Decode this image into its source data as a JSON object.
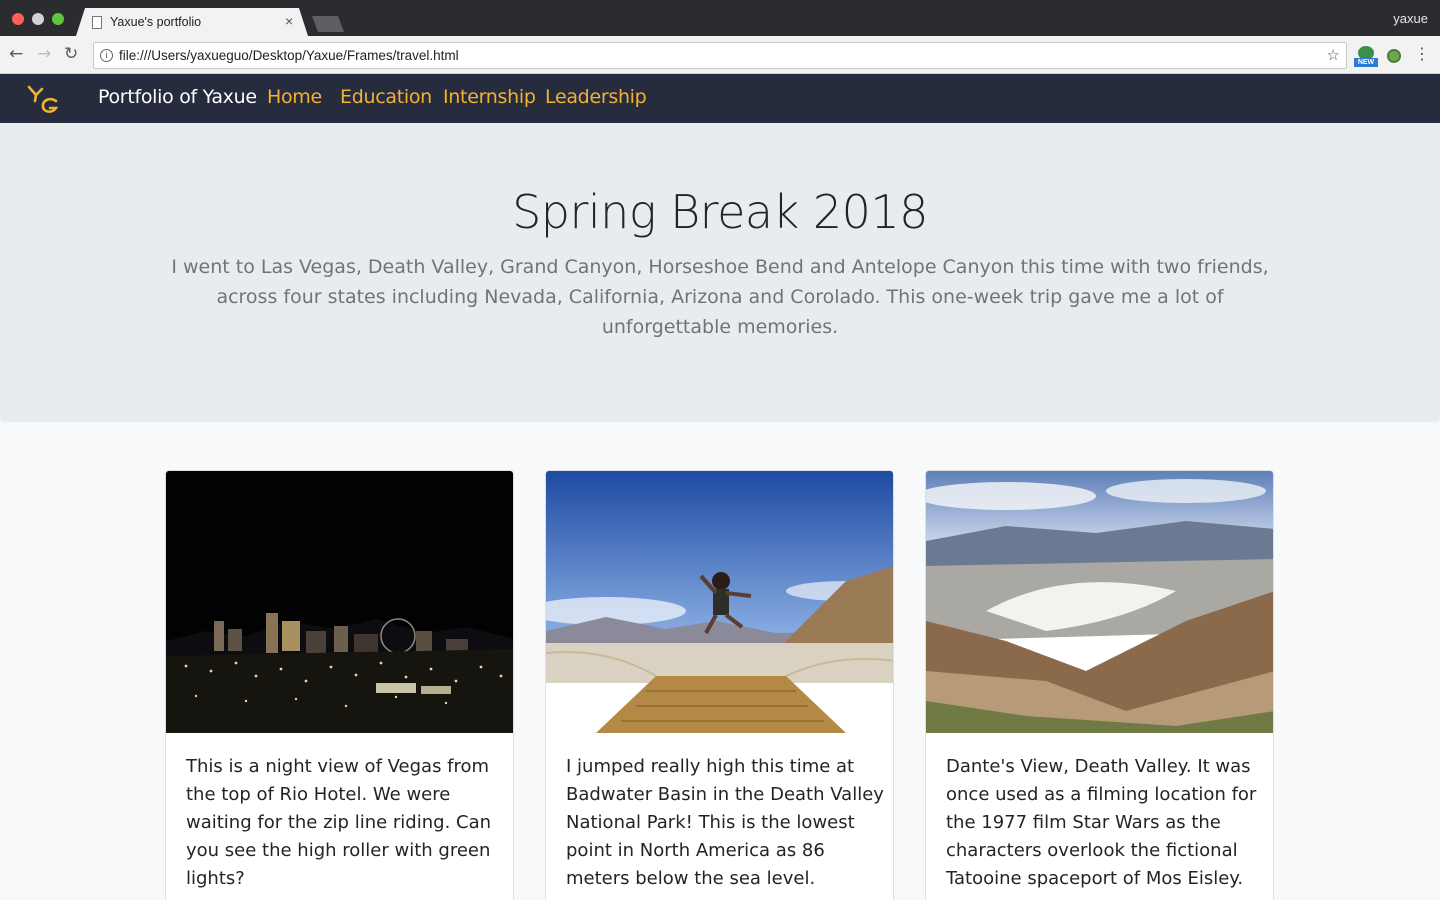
{
  "browser": {
    "tab_title": "Yaxue's portfolio",
    "tab_close": "×",
    "profile_name": "yaxue",
    "url": "file:///Users/yaxueguo/Desktop/Yaxue/Frames/travel.html",
    "back_icon": "←",
    "forward_icon": "→",
    "reload_icon": "↻",
    "star_icon": "☆",
    "menu_icon": "⋮",
    "info_icon": "i",
    "extension_badge": "NEW"
  },
  "navbar": {
    "logo_text": "YG",
    "brand": "Portfolio of Yaxue",
    "links": [
      "Home",
      "Education",
      "Internship",
      "Leadership"
    ],
    "link_color": "#f3b230",
    "background": "#262b3d"
  },
  "hero": {
    "title": "Spring Break 2018",
    "lead": "I went to Las Vegas, Death Valley, Grand Canyon, Horseshoe Bend and Antelope Canyon this time with two friends, across four states including Nevada, California, Arizona and Corolado. This one-week trip gave me a lot of unforgettable memories."
  },
  "cards": [
    {
      "image": "night-view-of-las-vegas",
      "text": "This is a night view of Vegas from the top of Rio Hotel. We were waiting for the zip line riding. Can you see the high roller with green lights?"
    },
    {
      "image": "jump-at-badwater-basin",
      "text": "I jumped really high this time at Badwater Basin in the Death Valley National Park! This is the lowest point in North America as 86 meters below the sea level."
    },
    {
      "image": "dantes-view-death-valley",
      "text": "Dante's View, Death Valley. It was once used as a filming location for the 1977 film Star Wars as the characters overlook the fictional Tatooine spaceport of Mos Eisley."
    }
  ]
}
